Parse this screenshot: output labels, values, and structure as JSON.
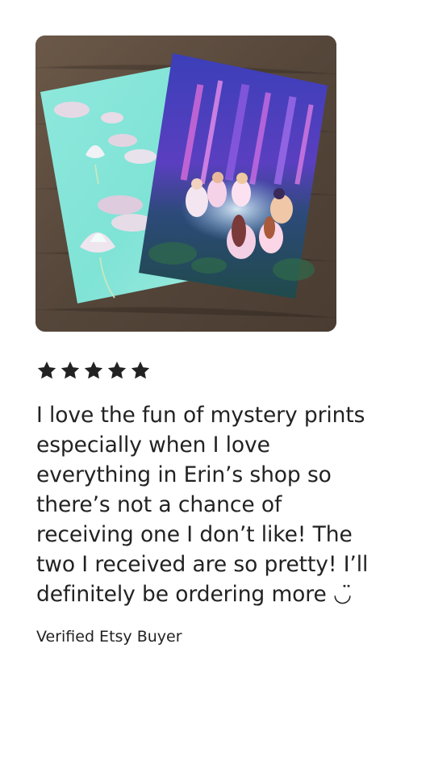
{
  "review": {
    "rating": 5,
    "rating_max": 5,
    "lines": [
      "I love the fun of mystery prints",
      "especially when I love",
      "everything in Erin’s shop so",
      "there’s not a chance of",
      "receiving one I don’t like! The",
      "two I received are so pretty! I’ll",
      "definitely be ordering more ◡̈"
    ],
    "author": "Verified Etsy Buyer"
  },
  "icons": {
    "star": "star-icon"
  },
  "colors": {
    "text": "#222222",
    "star": "#222222",
    "background": "#ffffff"
  }
}
